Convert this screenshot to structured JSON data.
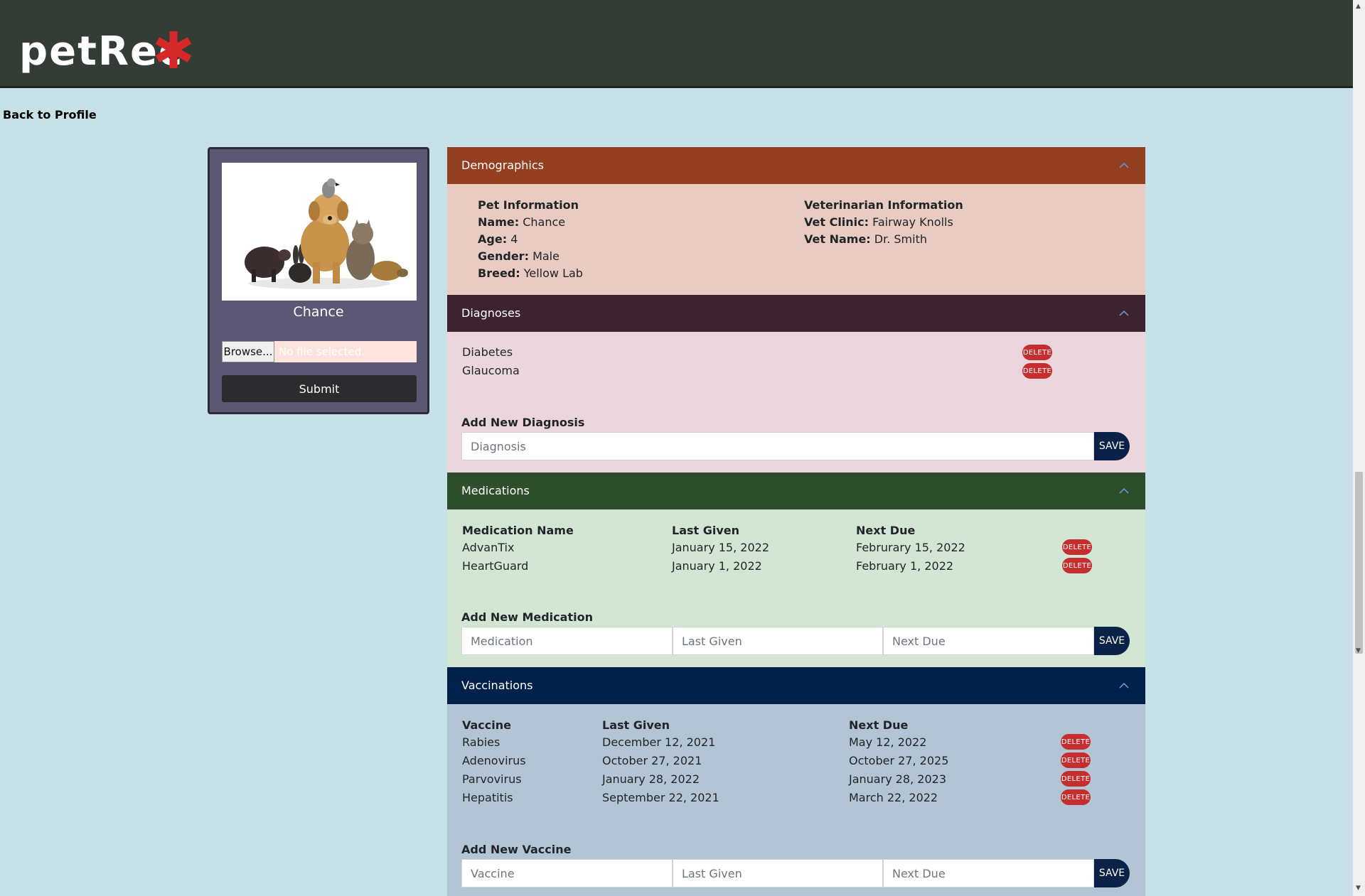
{
  "app": {
    "logo_text": "petRec"
  },
  "nav": {
    "back_label": "Back to Profile"
  },
  "profile": {
    "pet_name": "Chance",
    "browse_label": "Browse...",
    "file_status": "No file selected.",
    "submit_label": "Submit"
  },
  "demographics": {
    "header": "Demographics",
    "pet_info_title": "Pet Information",
    "name_label": "Name:",
    "name_value": "Chance",
    "age_label": "Age:",
    "age_value": "4",
    "gender_label": "Gender:",
    "gender_value": "Male",
    "breed_label": "Breed:",
    "breed_value": "Yellow Lab",
    "vet_info_title": "Veterinarian Information",
    "clinic_label": "Vet Clinic:",
    "clinic_value": "Fairway Knolls",
    "vet_name_label": "Vet Name:",
    "vet_name_value": "Dr. Smith"
  },
  "diagnoses": {
    "header": "Diagnoses",
    "items": [
      "Diabetes",
      "Glaucoma"
    ],
    "delete_label": "DELETE",
    "add_title": "Add New Diagnosis",
    "placeholder": "Diagnosis",
    "save_label": "SAVE"
  },
  "medications": {
    "header": "Medications",
    "columns": [
      "Medication Name",
      "Last Given",
      "Next Due"
    ],
    "rows": [
      [
        "AdvanTix",
        "January 15, 2022",
        "Februrary 15, 2022"
      ],
      [
        "HeartGuard",
        "January 1, 2022",
        "February 1, 2022"
      ]
    ],
    "delete_label": "DELETE",
    "add_title": "Add New Medication",
    "placeholders": [
      "Medication",
      "Last Given",
      "Next Due"
    ],
    "save_label": "SAVE"
  },
  "vaccinations": {
    "header": "Vaccinations",
    "columns": [
      "Vaccine",
      "Last Given",
      "Next Due"
    ],
    "rows": [
      [
        "Rabies",
        "December 12, 2021",
        "May 12, 2022"
      ],
      [
        "Adenovirus",
        "October 27, 2021",
        "October 27, 2025"
      ],
      [
        "Parvovirus",
        "January 28, 2022",
        "January 28, 2023"
      ],
      [
        "Hepatitis",
        "September 22, 2021",
        "March 22, 2022"
      ]
    ],
    "delete_label": "DELETE",
    "add_title": "Add New Vaccine",
    "placeholders": [
      "Vaccine",
      "Last Given",
      "Next Due"
    ],
    "save_label": "SAVE"
  },
  "colors": {
    "header_bg": "#333d36",
    "page_bg": "#c8e0e8",
    "logo_star": "#d62828",
    "delete_red": "#c42e2e",
    "save_navy": "#0a2247"
  },
  "icons": {
    "logo": "asterisk-icon",
    "section_toggle": "chevron-up-icon"
  }
}
